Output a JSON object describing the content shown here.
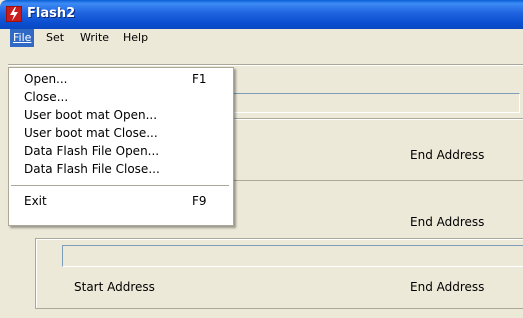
{
  "window": {
    "title": "Flash2",
    "app_icon": "flash-lightning-icon"
  },
  "menubar": {
    "items": [
      {
        "label": "File",
        "mnemonic": "F",
        "active": true
      },
      {
        "label": "Set",
        "mnemonic": "S"
      },
      {
        "label": "Write",
        "mnemonic": "W"
      },
      {
        "label": "Help",
        "mnemonic": "H"
      }
    ]
  },
  "file_menu": {
    "items": [
      {
        "label": "Open...",
        "shortcut": "F1"
      },
      {
        "label": "Close...",
        "shortcut": ""
      },
      {
        "label": "User boot mat Open...",
        "shortcut": ""
      },
      {
        "label": "User boot mat Close...",
        "shortcut": ""
      },
      {
        "label": "Data Flash File Open...",
        "shortcut": ""
      },
      {
        "label": "Data Flash File Close...",
        "shortcut": ""
      },
      {
        "label": "Exit",
        "shortcut": "F9"
      }
    ]
  },
  "main": {
    "sections": [
      {
        "start_label": "",
        "end_label": "End Address"
      },
      {
        "start_label": "Start Address",
        "end_label": "End Address"
      },
      {
        "start_label": "Start Address",
        "end_label": "End Address"
      }
    ]
  },
  "colors": {
    "titlebar": "#0a5fd6",
    "menu_highlight": "#316ac5",
    "background": "#ece9d8"
  }
}
